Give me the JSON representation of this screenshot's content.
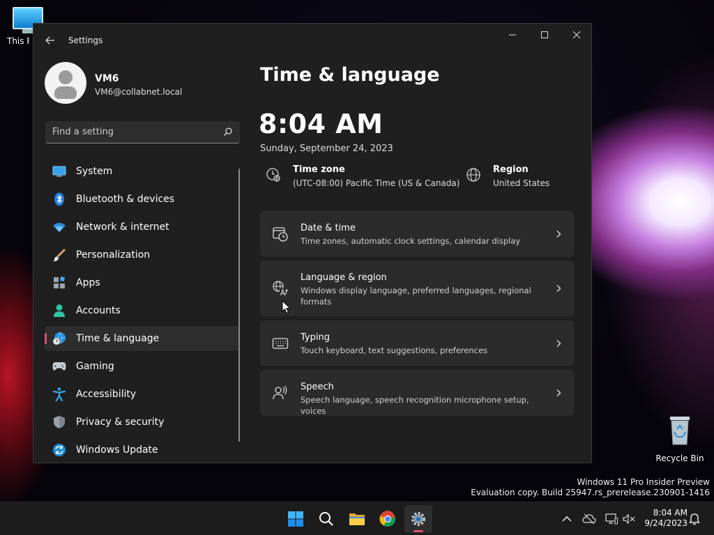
{
  "desktop": {
    "this_pc_label": "This PC",
    "recycle_label": "Recycle Bin",
    "watermark_line1": "Windows 11 Pro Insider Preview",
    "watermark_line2": "Evaluation copy. Build 25947.rs_prerelease.230901-1416"
  },
  "window": {
    "title": "Settings"
  },
  "profile": {
    "name": "VM6",
    "email": "VM6@collabnet.local"
  },
  "search": {
    "placeholder": "Find a setting"
  },
  "sidebar": {
    "items": [
      {
        "label": "System",
        "icon": "monitor-icon"
      },
      {
        "label": "Bluetooth & devices",
        "icon": "bluetooth-icon"
      },
      {
        "label": "Network & internet",
        "icon": "wifi-icon"
      },
      {
        "label": "Personalization",
        "icon": "brush-icon"
      },
      {
        "label": "Apps",
        "icon": "apps-icon"
      },
      {
        "label": "Accounts",
        "icon": "person-icon"
      },
      {
        "label": "Time & language",
        "icon": "globe-clock-icon",
        "active": true
      },
      {
        "label": "Gaming",
        "icon": "gamepad-icon"
      },
      {
        "label": "Accessibility",
        "icon": "accessibility-icon"
      },
      {
        "label": "Privacy & security",
        "icon": "shield-icon"
      },
      {
        "label": "Windows Update",
        "icon": "update-icon"
      }
    ]
  },
  "main": {
    "title": "Time & language",
    "time": "8:04 AM",
    "date": "Sunday, September 24, 2023",
    "timezone": {
      "title": "Time zone",
      "value": "(UTC-08:00) Pacific Time (US & Canada)"
    },
    "region": {
      "title": "Region",
      "value": "United States"
    },
    "cards": [
      {
        "title": "Date & time",
        "desc": "Time zones, automatic clock settings, calendar display"
      },
      {
        "title": "Language & region",
        "desc": "Windows display language, preferred languages, regional formats"
      },
      {
        "title": "Typing",
        "desc": "Touch keyboard, text suggestions, preferences"
      },
      {
        "title": "Speech",
        "desc": "Speech language, speech recognition microphone setup, voices"
      }
    ]
  },
  "taskbar": {
    "time": "8:04 AM",
    "date": "9/24/2023"
  },
  "colors": {
    "accent": "#e0506a",
    "window_bg": "#1f1f1f",
    "card_bg": "#2b2b2b"
  }
}
